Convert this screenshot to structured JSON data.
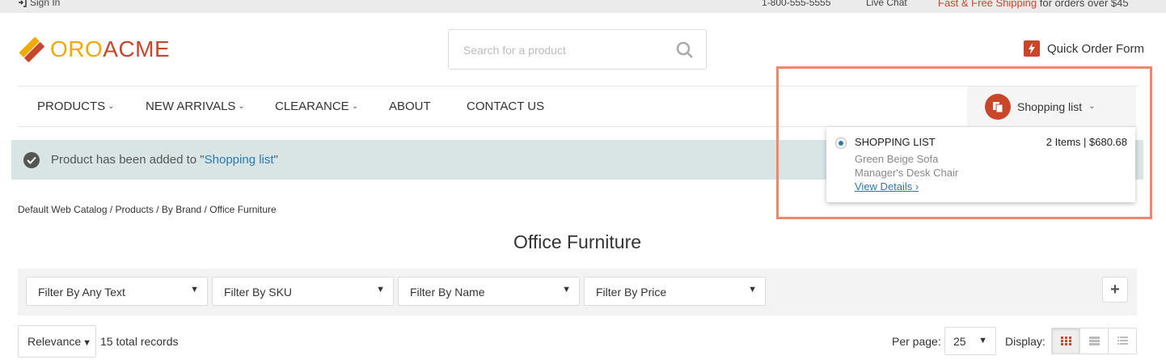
{
  "topbar": {
    "signin_label": "Sign In",
    "phone": "1-800-555-5555",
    "live_chat": "Live Chat",
    "promo_highlight": "Fast & Free Shipping",
    "promo_rest": "for orders over $45"
  },
  "logo": {
    "part1": "ORO",
    "part2": "ACME"
  },
  "search": {
    "placeholder": "Search for a product"
  },
  "quick_order": {
    "label": "Quick Order Form"
  },
  "nav": {
    "items": [
      {
        "label": "PRODUCTS"
      },
      {
        "label": "NEW ARRIVALS"
      },
      {
        "label": "CLEARANCE"
      },
      {
        "label": "ABOUT"
      },
      {
        "label": "CONTACT US"
      }
    ],
    "shopping_list_label": "Shopping list"
  },
  "flash": {
    "text_before": "Product has been added to \"",
    "link": "Shopping list",
    "text_after": "\""
  },
  "shopping_list_dropdown": {
    "name": "SHOPPING LIST",
    "summary": "2 Items | $680.68",
    "items": [
      "Green Beige Sofa",
      "Manager's Desk Chair"
    ],
    "view_details": "View Details"
  },
  "breadcrumb": "Default Web Catalog / Products / By Brand / Office Furniture",
  "page_title": "Office Furniture",
  "filters": [
    {
      "label": "Filter By Any Text"
    },
    {
      "label": "Filter By SKU"
    },
    {
      "label": "Filter By Name"
    },
    {
      "label": "Filter By Price"
    }
  ],
  "toolbar": {
    "sort_label": "Relevance",
    "total_records": "15 total records",
    "per_page_label": "Per page:",
    "per_page_value": "25",
    "display_label": "Display:"
  },
  "colors": {
    "accent": "#c8462a",
    "link": "#2a7ab0",
    "highlight_border": "#f0876a",
    "flash_bg": "#d9e4e4"
  }
}
